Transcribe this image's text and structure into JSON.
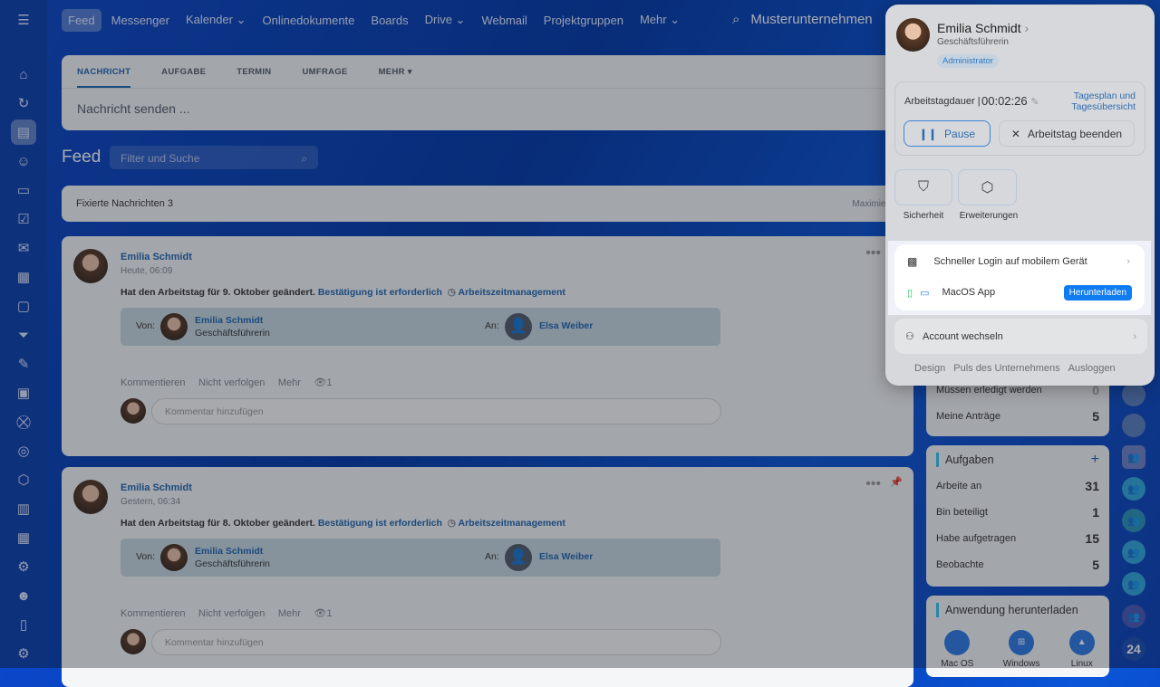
{
  "topbar": {
    "nav": [
      "Feed",
      "Messenger",
      "Kalender ⌄",
      "Onlinedokumente",
      "Boards",
      "Drive ⌄",
      "Webmail",
      "Projektgruppen",
      "Mehr ⌄"
    ],
    "company": "Musterunternehmen"
  },
  "composer": {
    "tabs": [
      "NACHRICHT",
      "AUFGABE",
      "TERMIN",
      "UMFRAGE",
      "MEHR ▾"
    ],
    "placeholder": "Nachricht senden ..."
  },
  "feed": {
    "title": "Feed",
    "search_placeholder": "Filter und Suche",
    "pinned": "Fixierte Nachrichten 3",
    "maximize": "Maximieren"
  },
  "posts": [
    {
      "author": "Emilia Schmidt",
      "time": "Heute, 06:09",
      "text": "Hat den Arbeitstag für 9. Oktober geändert.",
      "confirm": "Bestätigung ist erforderlich",
      "tag": "Arbeitszeitmanagement",
      "from_label": "Von:",
      "from_name": "Emilia Schmidt",
      "from_role": "Geschäftsführerin",
      "to_label": "An:",
      "to_name": "Elsa Weiber",
      "actions": [
        "Kommentieren",
        "Nicht verfolgen",
        "Mehr"
      ],
      "views": "1",
      "comment_placeholder": "Kommentar hinzufügen"
    },
    {
      "author": "Emilia Schmidt",
      "time": "Gestern, 06:34",
      "text": "Hat den Arbeitstag für 8. Oktober geändert.",
      "confirm": "Bestätigung ist erforderlich",
      "tag": "Arbeitszeitmanagement",
      "from_label": "Von:",
      "from_name": "Emilia Schmidt",
      "from_role": "Geschäftsführerin",
      "to_label": "An:",
      "to_name": "Elsa Weiber",
      "actions": [
        "Kommentieren",
        "Nicht verfolgen",
        "Mehr"
      ],
      "views": "1",
      "comment_placeholder": "Kommentar hinzufügen"
    }
  ],
  "widgets": {
    "requests": [
      {
        "label": "Müssen erledigt werden",
        "value": "0"
      },
      {
        "label": "Meine Anträge",
        "value": "5"
      }
    ],
    "tasks": {
      "title": "Aufgaben",
      "add": "+",
      "rows": [
        {
          "label": "Arbeite an",
          "value": "31"
        },
        {
          "label": "Bin beteiligt",
          "value": "1"
        },
        {
          "label": "Habe aufgetragen",
          "value": "15"
        },
        {
          "label": "Beobachte",
          "value": "5"
        }
      ]
    },
    "download": {
      "title": "Anwendung herunterladen",
      "apps": [
        "Mac OS",
        "Windows",
        "Linux"
      ]
    }
  },
  "right_badge": "24",
  "popup": {
    "name": "Emilia Schmidt",
    "role": "Geschäftsführerin",
    "badge": "Administrator",
    "duration_label": "Arbeitstagdauer |",
    "duration": "00:02:26",
    "plan_link": "Tagesplan und Tagesübersicht",
    "pause": "Pause",
    "end": "Arbeitstag beenden",
    "tiles": [
      "Sicherheit",
      "Erweiterungen"
    ],
    "quick_login": "Schneller Login auf mobilem Gerät",
    "macos": "MacOS App",
    "download": "Herunterladen",
    "switch": "Account wechseln",
    "footer": [
      "Design",
      "Puls des Unternehmens",
      "Ausloggen"
    ]
  },
  "colors": {
    "accent": "#2067b0",
    "download_btn": "#0f7cf2"
  }
}
